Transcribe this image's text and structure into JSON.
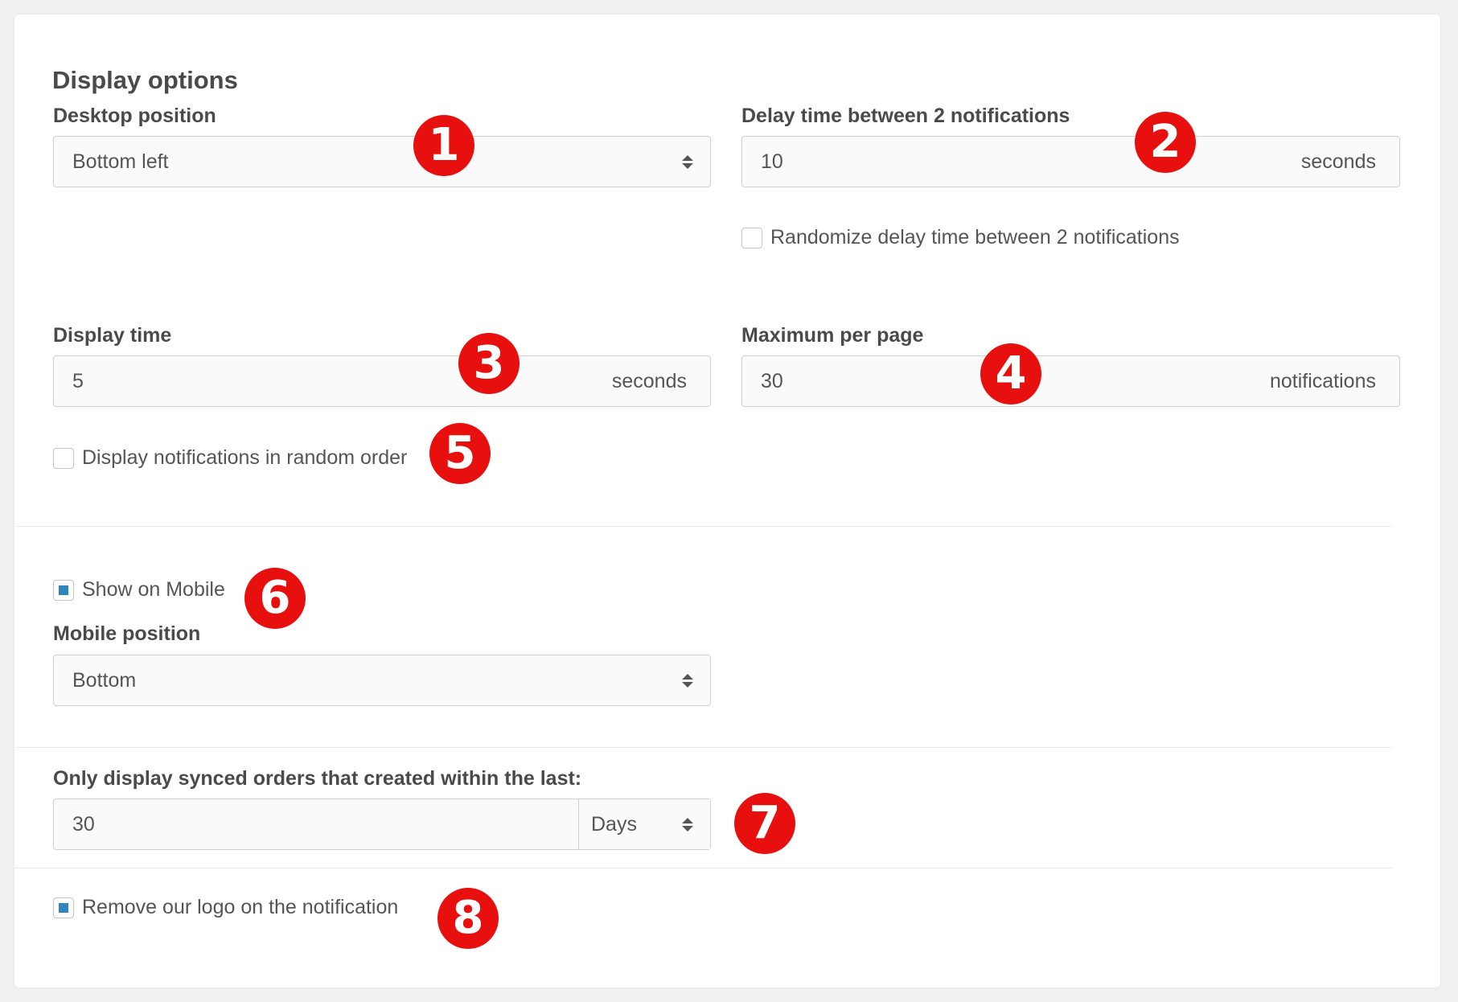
{
  "section_title": "Display options",
  "desktop_position": {
    "label": "Desktop position",
    "value": "Bottom left"
  },
  "delay_time": {
    "label": "Delay time between 2 notifications",
    "value": "10",
    "suffix": "seconds"
  },
  "randomize_delay": {
    "label": "Randomize delay time between 2 notifications",
    "checked": false
  },
  "display_time": {
    "label": "Display time",
    "value": "5",
    "suffix": "seconds"
  },
  "max_per_page": {
    "label": "Maximum per page",
    "value": "30",
    "suffix": "notifications"
  },
  "random_order": {
    "label": "Display notifications in random order",
    "checked": false
  },
  "show_on_mobile": {
    "label": "Show on Mobile",
    "checked": true
  },
  "mobile_position": {
    "label": "Mobile position",
    "value": "Bottom"
  },
  "synced_orders": {
    "label": "Only display synced orders that created within the last:",
    "value": "30",
    "unit": "Days"
  },
  "remove_logo": {
    "label": "Remove our logo on the notification",
    "checked": true
  },
  "badges": [
    "1",
    "2",
    "3",
    "4",
    "5",
    "6",
    "7",
    "8"
  ],
  "colors": {
    "badge": "#e8100f",
    "checkbox_checked": "#2e86c1",
    "card": "#ffffff",
    "page": "#f0f0f0"
  },
  "icons": {
    "select_arrows": "up-down-caret-icon"
  }
}
